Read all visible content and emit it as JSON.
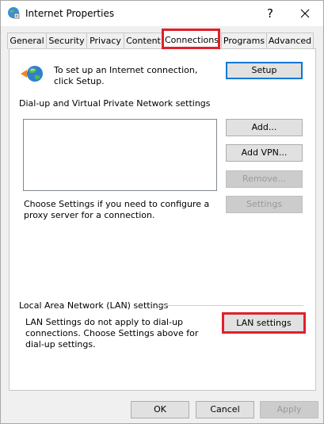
{
  "window": {
    "title": "Internet Properties",
    "help_label": "?",
    "icon": "internet-options-icon"
  },
  "tabs": [
    "General",
    "Security",
    "Privacy",
    "Content",
    "Connections",
    "Programs",
    "Advanced"
  ],
  "active_tab": "Connections",
  "setup": {
    "text": "To set up an Internet connection, click Setup.",
    "button": "Setup"
  },
  "dialup": {
    "heading": "Dial-up and Virtual Private Network settings",
    "items": [],
    "add_button": "Add...",
    "add_vpn_button": "Add VPN...",
    "remove_button": "Remove...",
    "proxy_text": "Choose Settings if you need to configure a proxy server for a connection.",
    "settings_button": "Settings"
  },
  "lan": {
    "heading": "Local Area Network (LAN) settings",
    "text": "LAN Settings do not apply to dial-up connections. Choose Settings above for dial-up settings.",
    "button": "LAN settings"
  },
  "footer": {
    "ok": "OK",
    "cancel": "Cancel",
    "apply": "Apply"
  },
  "colors": {
    "highlight": "#e0202a",
    "focus": "#0078d7"
  }
}
